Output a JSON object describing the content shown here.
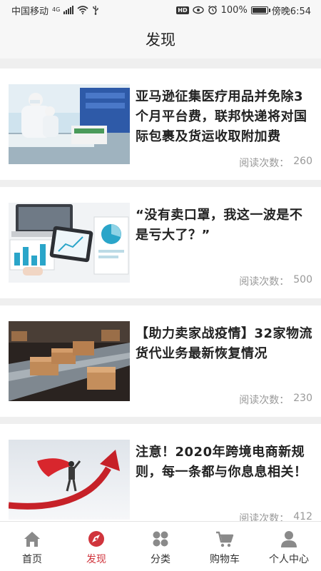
{
  "status_bar": {
    "carrier": "中国移动",
    "network": "4G",
    "battery_text": "100%",
    "time": "傍晚6:54",
    "battery_level": 1.0
  },
  "header": {
    "title": "发现"
  },
  "articles": [
    {
      "title": "亚马逊征集医疗用品并免除3个月平台费，联邦快递将对国际包裹及货运收取附加费",
      "reads_label": "阅读次数：",
      "reads": "260",
      "image": "medical-factory-workers"
    },
    {
      "title": "“没有卖口罩，我这一波是不是亏大了？”",
      "reads_label": "阅读次数：",
      "reads": "500",
      "image": "laptop-charts-desk"
    },
    {
      "title": "【助力卖家战疫情】32家物流货代业务最新恢复情况",
      "reads_label": "阅读次数：",
      "reads": "230",
      "image": "conveyor-boxes"
    },
    {
      "title": "注意！2020年跨境电商新规则，每一条都与你息息相关！",
      "reads_label": "阅读次数：",
      "reads": "412",
      "image": "superhero-red-arrow"
    }
  ],
  "bottom_nav": [
    {
      "label": "首页",
      "icon": "home-icon",
      "active": false
    },
    {
      "label": "发现",
      "icon": "discover-icon",
      "active": true
    },
    {
      "label": "分类",
      "icon": "category-icon",
      "active": false
    },
    {
      "label": "购物车",
      "icon": "cart-icon",
      "active": false
    },
    {
      "label": "个人中心",
      "icon": "user-icon",
      "active": false
    }
  ],
  "colors": {
    "accent": "#d0343c",
    "icon_gray": "#8a8a8a",
    "background": "#efefef"
  }
}
